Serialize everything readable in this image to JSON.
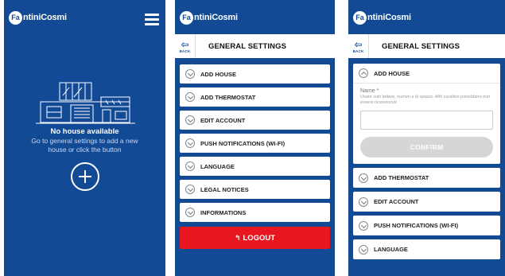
{
  "brand": {
    "logo_mark": "Fa",
    "logo_text": "ntiniCosmi"
  },
  "home": {
    "empty_title": "No house available",
    "empty_subtitle": "Go to general settings to add a new house or click the button"
  },
  "settings": {
    "title": "GENERAL SETTINGS",
    "back_label": "BACK",
    "items": [
      {
        "label": "ADD HOUSE"
      },
      {
        "label": "ADD THERMOSTAT"
      },
      {
        "label": "EDIT ACCOUNT"
      },
      {
        "label": "PUSH NOTIFICATIONS (WI-FI)"
      },
      {
        "label": "LANGUAGE"
      },
      {
        "label": "LEGAL NOTICES"
      },
      {
        "label": "INFORMATIONS"
      }
    ],
    "logout_label": "LOGOUT"
  },
  "add_house_form": {
    "name_label": "Name *",
    "name_hint": "Usare solo lettere, numeri e lo spazio. Altri caratteri potrebbero non essere riconosciuti.",
    "name_value": "",
    "confirm_label": "CONFIRM"
  },
  "colors": {
    "brand_blue": "#124a95",
    "logout_red": "#e8171f",
    "confirm_disabled": "#d6d6d6"
  }
}
